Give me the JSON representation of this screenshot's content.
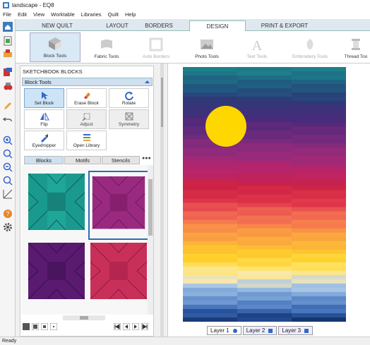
{
  "window": {
    "title": "landscape - EQ8"
  },
  "menu": [
    "File",
    "Edit",
    "View",
    "Worktable",
    "Libraries",
    "Quilt",
    "Help"
  ],
  "tabs": [
    "NEW QUILT",
    "LAYOUT",
    "BORDERS",
    "DESIGN",
    "PRINT & EXPORT"
  ],
  "ribbon": [
    "Block Tools",
    "Fabric Tools",
    "Auto Borders",
    "Photo Tools",
    "Text Tools",
    "Embroidery Tools",
    "Thread Too"
  ],
  "panel": {
    "title": "SKETCHBOOK BLOCKS",
    "section": "Block Tools",
    "tools": [
      "Set Block",
      "Erase Block",
      "Rotate",
      "Flip",
      "Adjust",
      "Symmetry",
      "Eyedropper",
      "Open Library"
    ],
    "subtabs": [
      "Blocks",
      "Motifs",
      "Stencils"
    ],
    "more": "●●●"
  },
  "layers": [
    "Layer 1",
    "Layer 2",
    "Layer 3"
  ],
  "status": "Ready",
  "colors": {
    "accent": "#2a6db5",
    "sun": "#ffd700"
  }
}
